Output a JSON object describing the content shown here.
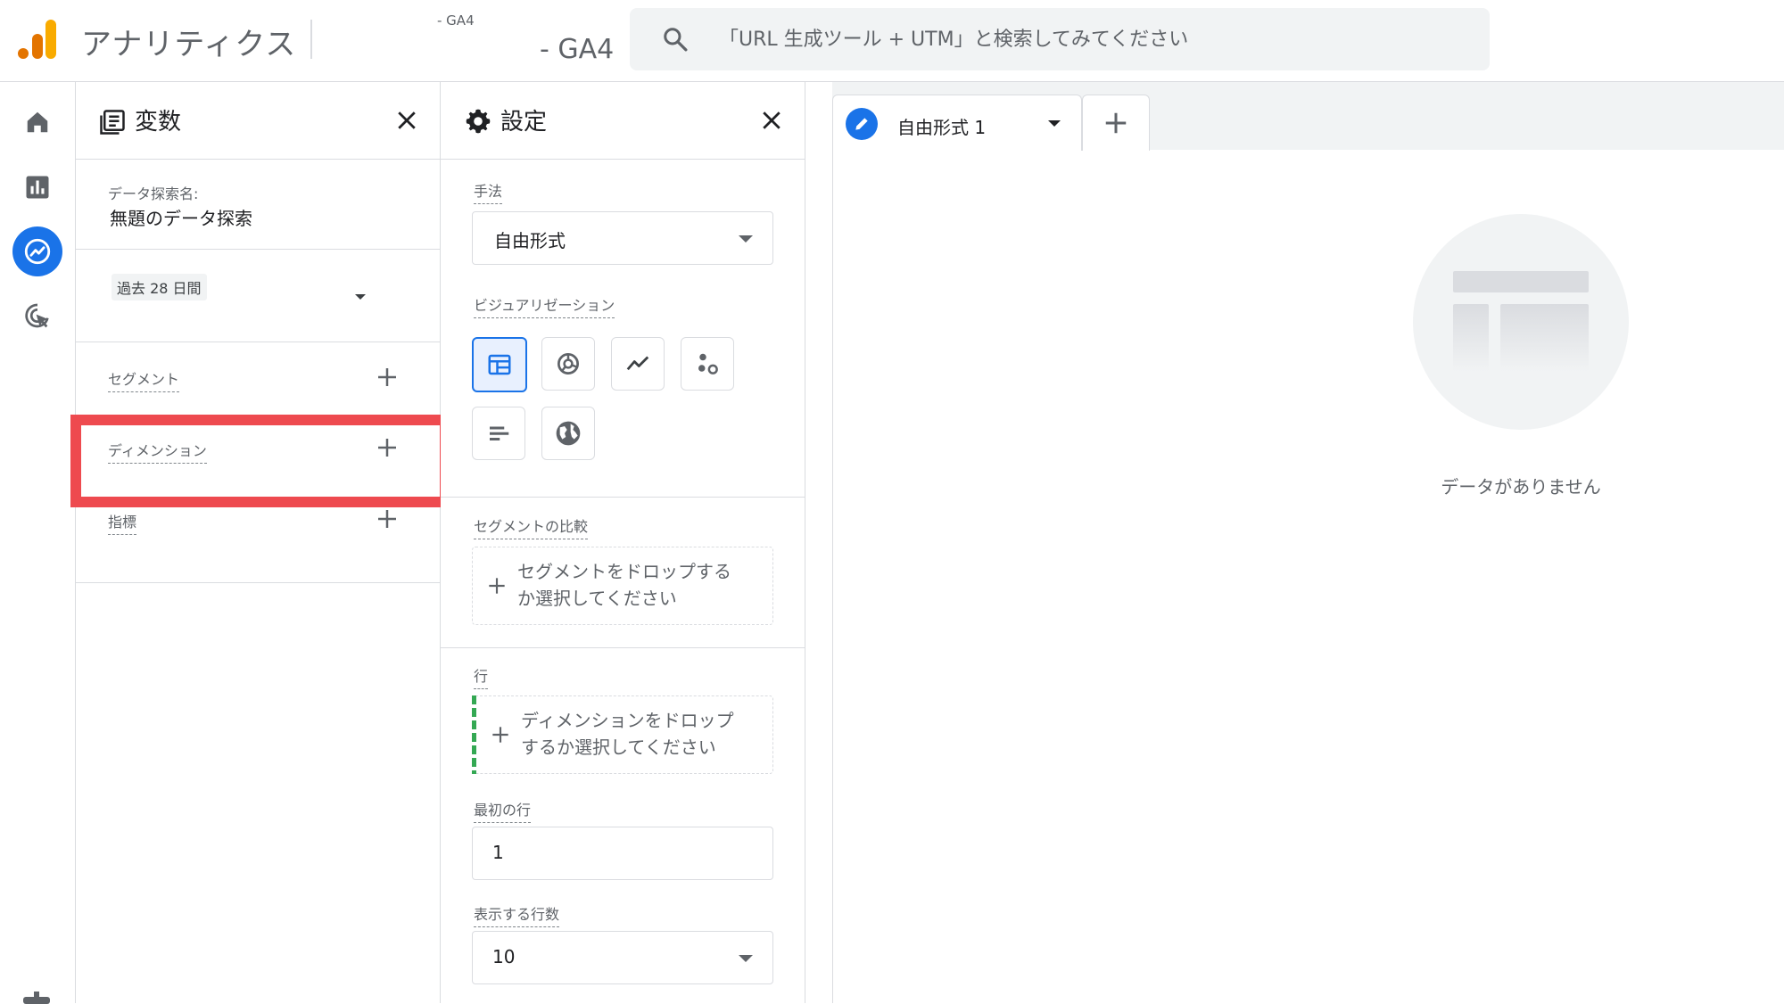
{
  "header": {
    "app_title": "アナリティクス",
    "account_name": "- GA4",
    "property_name": "- GA4",
    "search_placeholder": "「URL 生成ツール + UTM」と検索してみてください"
  },
  "nav": {
    "items": [
      {
        "name": "home",
        "icon": "home-icon"
      },
      {
        "name": "reports",
        "icon": "bar-chart-icon"
      },
      {
        "name": "explore",
        "icon": "explore-icon",
        "active": true
      },
      {
        "name": "advertising",
        "icon": "cursor-target-icon"
      }
    ]
  },
  "variables_panel": {
    "title": "変数",
    "exploration_name_label": "データ探索名:",
    "exploration_name": "無題のデータ探索",
    "date_range": "過去 28 日間",
    "segments_label": "セグメント",
    "dimensions_label": "ディメンション",
    "metrics_label": "指標"
  },
  "settings_panel": {
    "title": "設定",
    "technique_label": "手法",
    "technique_value": "自由形式",
    "visualization_label": "ビジュアリゼーション",
    "visualizations": [
      "table",
      "donut",
      "line",
      "scatter",
      "bar",
      "geo"
    ],
    "selected_visualization": "table",
    "segment_comparison_label": "セグメントの比較",
    "segment_drop_line1": "セグメントをドロップする",
    "segment_drop_line2": "か選択してください",
    "rows_label": "行",
    "rows_drop_line1": "ディメンションをドロップ",
    "rows_drop_line2": "するか選択してください",
    "first_row_label": "最初の行",
    "first_row_value": "1",
    "show_rows_label": "表示する行数",
    "show_rows_value": "10"
  },
  "tabs": {
    "items": [
      {
        "label": "自由形式 1"
      }
    ]
  },
  "canvas": {
    "empty_message": "データがありません"
  },
  "colors": {
    "accent": "#1a73e8",
    "highlight": "#ee4a4f",
    "logo_orange": "#f9ab00",
    "logo_dark_orange": "#e37400"
  }
}
